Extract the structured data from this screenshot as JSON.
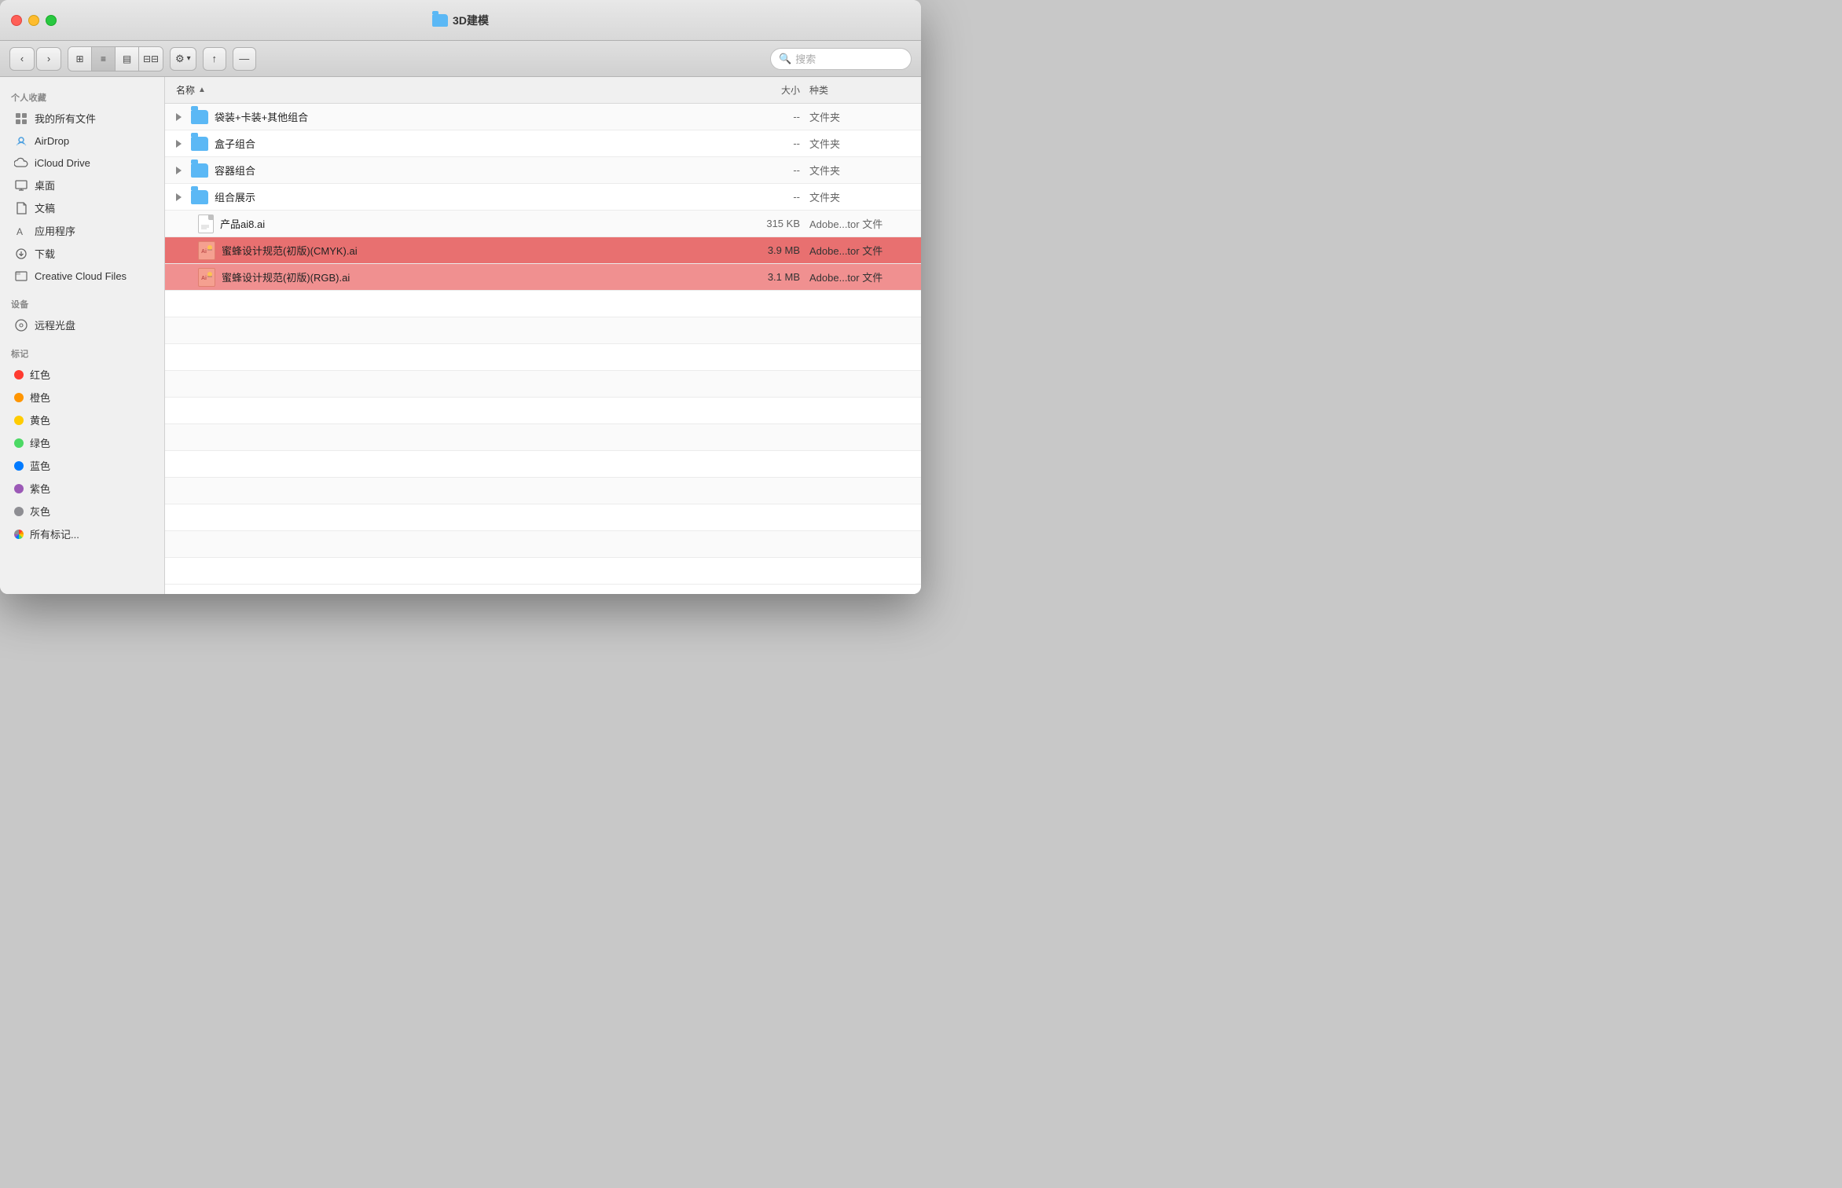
{
  "window": {
    "title": "3D建模",
    "folder_icon": "📁"
  },
  "toolbar": {
    "back_label": "‹",
    "forward_label": "›",
    "view_icon_label": "⊞",
    "view_list_label": "≡",
    "view_column_label": "⊟",
    "view_gallery_label": "⊟⊟",
    "action_label": "⚙",
    "share_label": "↑",
    "path_label": "—",
    "search_placeholder": "搜索"
  },
  "sidebar": {
    "personal_section": "个人收藏",
    "device_section": "设备",
    "tag_section": "标记",
    "items": [
      {
        "id": "allfiles",
        "label": "我的所有文件",
        "icon": "allfiles"
      },
      {
        "id": "airdrop",
        "label": "AirDrop",
        "icon": "airdrop"
      },
      {
        "id": "icloud",
        "label": "iCloud Drive",
        "icon": "icloud"
      },
      {
        "id": "desktop",
        "label": "桌面",
        "icon": "desktop"
      },
      {
        "id": "docs",
        "label": "文稿",
        "icon": "docs"
      },
      {
        "id": "apps",
        "label": "应用程序",
        "icon": "apps"
      },
      {
        "id": "downloads",
        "label": "下载",
        "icon": "downloads"
      },
      {
        "id": "ccfiles",
        "label": "Creative Cloud Files",
        "icon": "ccfiles"
      }
    ],
    "devices": [
      {
        "id": "optical",
        "label": "远程光盘",
        "icon": "optical"
      }
    ],
    "tags": [
      {
        "id": "red",
        "label": "红色",
        "color": "#ff3b30"
      },
      {
        "id": "orange",
        "label": "橙色",
        "color": "#ff9500"
      },
      {
        "id": "yellow",
        "label": "黄色",
        "color": "#ffcc00"
      },
      {
        "id": "green",
        "label": "绿色",
        "color": "#4cd964"
      },
      {
        "id": "blue",
        "label": "蓝色",
        "color": "#007aff"
      },
      {
        "id": "purple",
        "label": "紫色",
        "color": "#9b59b6"
      },
      {
        "id": "gray",
        "label": "灰色",
        "color": "#8e8e93"
      },
      {
        "id": "alltags",
        "label": "所有标记...",
        "color": null
      }
    ]
  },
  "filelist": {
    "columns": [
      {
        "id": "name",
        "label": "名称",
        "sortable": true,
        "active": true
      },
      {
        "id": "size",
        "label": "大小",
        "sortable": false
      },
      {
        "id": "kind",
        "label": "种类",
        "sortable": false
      }
    ],
    "rows": [
      {
        "id": 1,
        "name": "袋装+卡装+其他组合",
        "type": "folder",
        "size": "--",
        "kind": "文件夹",
        "selected": false,
        "expanded": false
      },
      {
        "id": 2,
        "name": "盒子组合",
        "type": "folder",
        "size": "--",
        "kind": "文件夹",
        "selected": false,
        "expanded": false
      },
      {
        "id": 3,
        "name": "容器组合",
        "type": "folder",
        "size": "--",
        "kind": "文件夹",
        "selected": false,
        "expanded": false
      },
      {
        "id": 4,
        "name": "组合展示",
        "type": "folder",
        "size": "--",
        "kind": "文件夹",
        "selected": false,
        "expanded": false
      },
      {
        "id": 5,
        "name": "产品ai8.ai",
        "type": "doc",
        "size": "315 KB",
        "kind": "Adobe...tor 文件",
        "selected": false
      },
      {
        "id": 6,
        "name": "蜜蜂设计规范(初版)(CMYK).ai",
        "type": "ai-bee",
        "size": "3.9 MB",
        "kind": "Adobe...tor 文件",
        "selected": true
      },
      {
        "id": 7,
        "name": "蜜蜂设计规范(初版)(RGB).ai",
        "type": "ai-bee",
        "size": "3.1 MB",
        "kind": "Adobe...tor 文件",
        "selected": true
      }
    ]
  }
}
